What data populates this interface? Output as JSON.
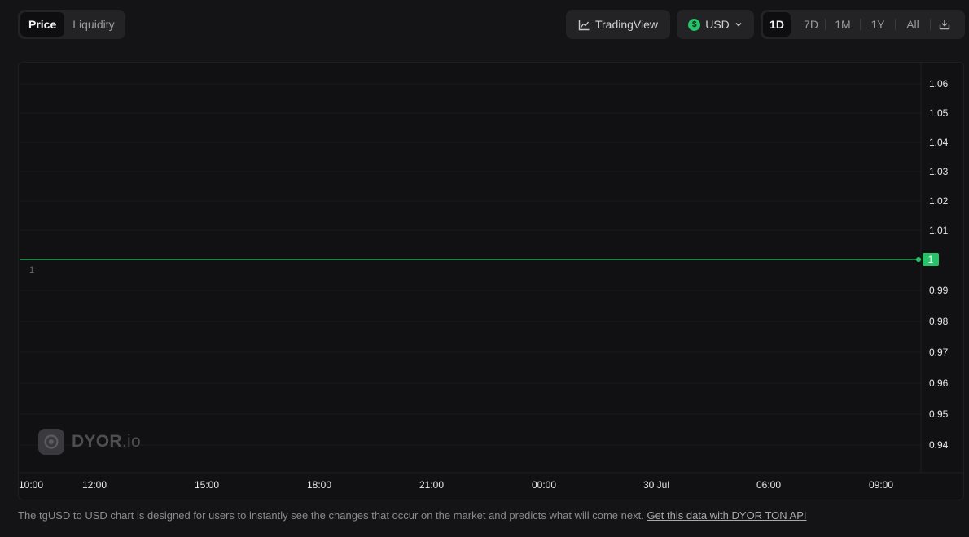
{
  "toggle": {
    "price": "Price",
    "liquidity": "Liquidity",
    "active": "Price"
  },
  "tradingview": {
    "label": "TradingView"
  },
  "currency": {
    "label": "USD",
    "symbol": "$"
  },
  "ranges": [
    "1D",
    "7D",
    "1M",
    "1Y",
    "All"
  ],
  "active_range": "1D",
  "watermark": {
    "brand": "DYOR",
    "suffix": ".io"
  },
  "footer": {
    "text": "The tgUSD to USD chart is designed for users to instantly see the changes that occur on the market and predicts what will come next.",
    "link": "Get this data with DYOR TON API"
  },
  "colors": {
    "line": "#27c26a",
    "badge": "#27c26a",
    "grid": "#1c1c1f",
    "label": "#e8e8ea"
  },
  "chart_data": {
    "type": "line",
    "y_ticks": [
      1.06,
      1.05,
      1.04,
      1.03,
      1.02,
      1.01,
      1,
      0.99,
      0.98,
      0.97,
      0.96,
      0.95,
      0.94
    ],
    "x_ticks": [
      "10:00",
      "12:00",
      "15:00",
      "18:00",
      "21:00",
      "00:00",
      "30 Jul",
      "06:00",
      "09:00"
    ],
    "series": [
      {
        "values": [
          1,
          1,
          1,
          1,
          1,
          1,
          1,
          1,
          1,
          1
        ]
      }
    ],
    "last_value": "1",
    "series_label": "1",
    "grid": true
  }
}
